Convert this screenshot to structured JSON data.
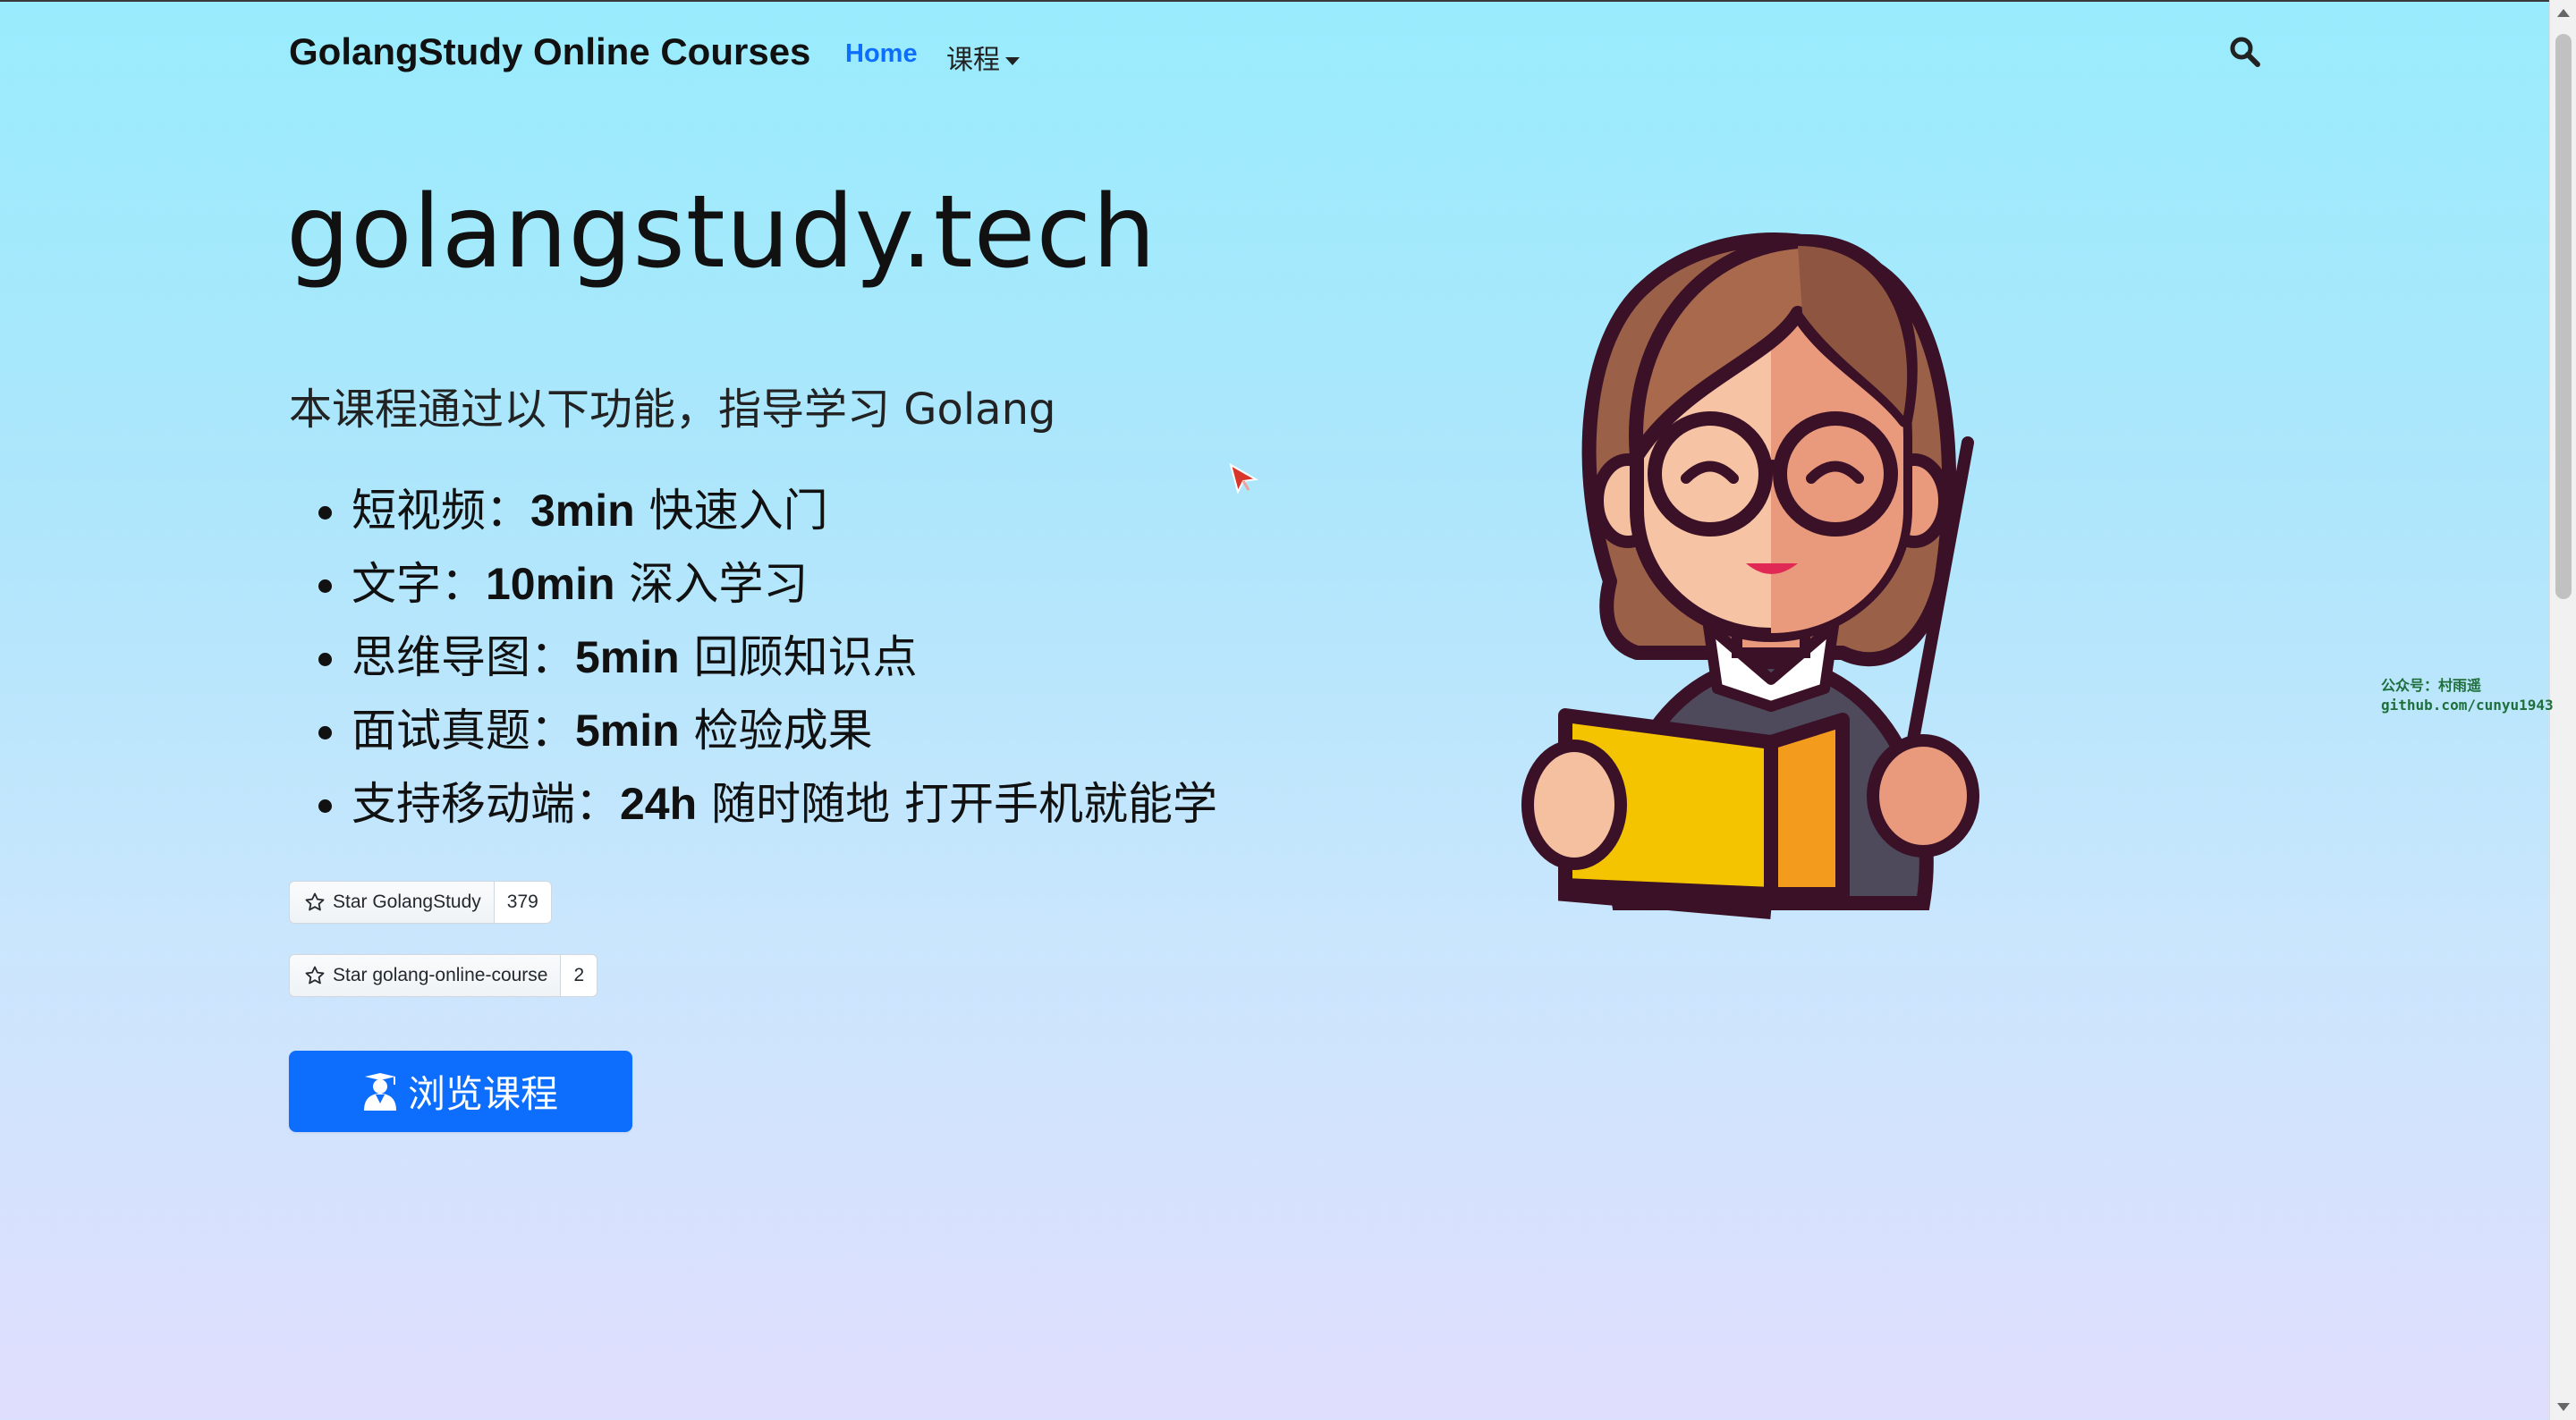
{
  "navbar": {
    "brand": "GolangStudy Online Courses",
    "home_label": "Home",
    "courses_label": "课程",
    "search_icon": "search-icon"
  },
  "hero": {
    "title": "golangstudy.tech",
    "lead": "本课程通过以下功能，指导学习 Golang",
    "features": [
      {
        "label": "短视频：",
        "highlight": "3min",
        "rest": " 快速入门"
      },
      {
        "label": "文字：",
        "highlight": "10min",
        "rest": " 深入学习"
      },
      {
        "label": "思维导图：",
        "highlight": "5min",
        "rest": " 回顾知识点"
      },
      {
        "label": "面试真题：",
        "highlight": "5min",
        "rest": " 检验成果"
      },
      {
        "label": "支持移动端：",
        "highlight": "24h",
        "rest": " 随时随地 打开手机就能学"
      }
    ]
  },
  "github_buttons": [
    {
      "label": "Star GolangStudy",
      "count": "379",
      "icon": "star-icon"
    },
    {
      "label": "Star golang-online-course",
      "count": "2",
      "icon": "star-icon"
    }
  ],
  "cta": {
    "label": "浏览课程",
    "icon": "graduate-icon"
  },
  "watermark": {
    "line1": "公众号：村雨遥",
    "line2": "github.com/cunyu1943"
  },
  "colors": {
    "accent": "#0d6efd",
    "bg_top": "#99ecfd",
    "bg_bottom": "#e0defd"
  }
}
